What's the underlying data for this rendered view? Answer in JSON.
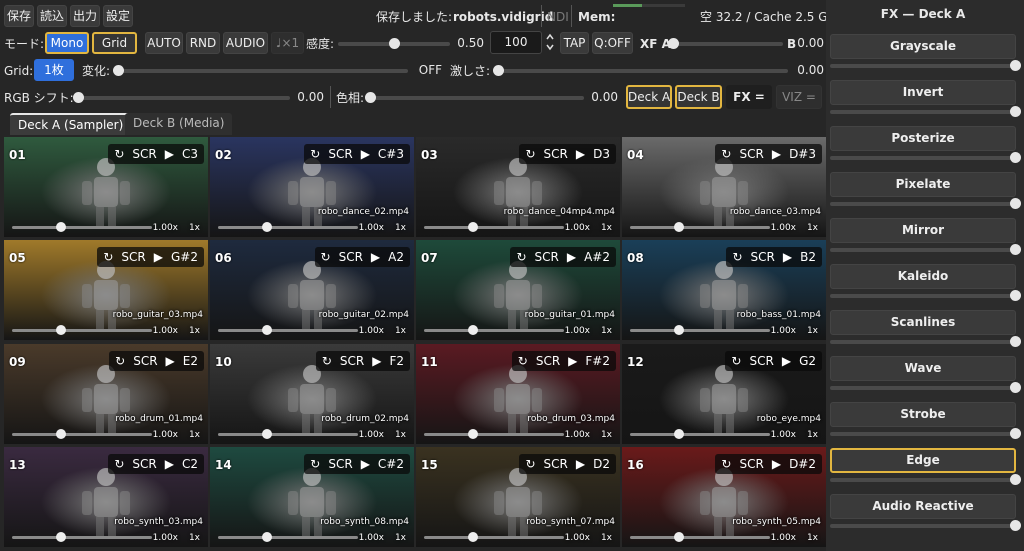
{
  "menu": {
    "save": "保存",
    "load": "読込",
    "output": "出力",
    "settings": "設定"
  },
  "status": {
    "saved_label": "保存しました:",
    "saved_file": "robots.vidigrid",
    "ndi": "NDI",
    "mem_label": "Mem:",
    "mem_value": "空 32.2 / Cache 2.5 GB",
    "mem_fraction": 0.4
  },
  "controls": {
    "mode_label": "モード:",
    "mode_mono": "Mono",
    "mode_grid": "Grid",
    "auto": "AUTO",
    "rnd": "RND",
    "audio": "AUDIO",
    "note": "♩×1",
    "sensitivity_label": "感度:",
    "sensitivity_value": "0.50",
    "sensitivity_fraction": 0.5,
    "bpm_value": "100",
    "tap": "TAP",
    "qoff": "Q:OFF",
    "xf_label": "XF A",
    "xf_b": "B",
    "xf_value": "0.00",
    "xf_fraction": 0.0,
    "grid_label": "Grid:",
    "grid_value": "1枚",
    "change_label": "変化:",
    "change_value": "OFF",
    "change_fraction": 0.0,
    "intensity_label": "激しさ:",
    "intensity_value": "0.00",
    "intensity_fraction": 0.0,
    "rgb_label": "RGB シフト:",
    "rgb_value": "0.00",
    "rgb_fraction": 0.0,
    "hue_label": "色相:",
    "hue_value": "0.00",
    "hue_fraction": 0.0,
    "deck_a": "Deck A",
    "deck_b": "Deck B",
    "fx_eq": "FX =",
    "viz_eq": "VIZ ="
  },
  "tabs": [
    "Deck A (Sampler)",
    "Deck B (Media)"
  ],
  "cells": [
    {
      "num": "01",
      "scr": "SCR",
      "key": "C3",
      "file": "",
      "speed": "1.00x",
      "mul": "1x",
      "pos": 0.35,
      "bg": "#2f5a3e"
    },
    {
      "num": "02",
      "scr": "SCR",
      "key": "C#3",
      "file": "robo_dance_02.mp4",
      "speed": "1.00x",
      "mul": "1x",
      "pos": 0.35,
      "bg": "#2a3560"
    },
    {
      "num": "03",
      "scr": "SCR",
      "key": "D3",
      "file": "robo_dance_04mp4.mp4",
      "speed": "1.00x",
      "mul": "1x",
      "pos": 0.35,
      "bg": "#2a2a2a"
    },
    {
      "num": "04",
      "scr": "SCR",
      "key": "D#3",
      "file": "robo_dance_03.mp4",
      "speed": "1.00x",
      "mul": "1x",
      "pos": 0.35,
      "bg": "#6a6a6a"
    },
    {
      "num": "05",
      "scr": "SCR",
      "key": "G#2",
      "file": "robo_guitar_03.mp4",
      "speed": "1.00x",
      "mul": "1x",
      "pos": 0.35,
      "bg": "#a07a2a"
    },
    {
      "num": "06",
      "scr": "SCR",
      "key": "A2",
      "file": "robo_guitar_02.mp4",
      "speed": "1.00x",
      "mul": "1x",
      "pos": 0.35,
      "bg": "#1e2a3e"
    },
    {
      "num": "07",
      "scr": "SCR",
      "key": "A#2",
      "file": "robo_guitar_01.mp4",
      "speed": "1.00x",
      "mul": "1x",
      "pos": 0.35,
      "bg": "#1e4a3a"
    },
    {
      "num": "08",
      "scr": "SCR",
      "key": "B2",
      "file": "robo_bass_01.mp4",
      "speed": "1.00x",
      "mul": "1x",
      "pos": 0.35,
      "bg": "#1a3f58"
    },
    {
      "num": "09",
      "scr": "SCR",
      "key": "E2",
      "file": "robo_drum_01.mp4",
      "speed": "1.00x",
      "mul": "1x",
      "pos": 0.35,
      "bg": "#4a3a2a"
    },
    {
      "num": "10",
      "scr": "SCR",
      "key": "F2",
      "file": "robo_drum_02.mp4",
      "speed": "1.00x",
      "mul": "1x",
      "pos": 0.35,
      "bg": "#3a3a3a"
    },
    {
      "num": "11",
      "scr": "SCR",
      "key": "F#2",
      "file": "robo_drum_03.mp4",
      "speed": "1.00x",
      "mul": "1x",
      "pos": 0.35,
      "bg": "#5a1a22"
    },
    {
      "num": "12",
      "scr": "SCR",
      "key": "G2",
      "file": "robo_eye.mp4",
      "speed": "1.00x",
      "mul": "1x",
      "pos": 0.35,
      "bg": "#1a1a1a"
    },
    {
      "num": "13",
      "scr": "SCR",
      "key": "C2",
      "file": "robo_synth_03.mp4",
      "speed": "1.00x",
      "mul": "1x",
      "pos": 0.35,
      "bg": "#3a2a40"
    },
    {
      "num": "14",
      "scr": "SCR",
      "key": "C#2",
      "file": "robo_synth_08.mp4",
      "speed": "1.00x",
      "mul": "1x",
      "pos": 0.35,
      "bg": "#1e4a40"
    },
    {
      "num": "15",
      "scr": "SCR",
      "key": "D2",
      "file": "robo_synth_07.mp4",
      "speed": "1.00x",
      "mul": "1x",
      "pos": 0.35,
      "bg": "#3a3220"
    },
    {
      "num": "16",
      "scr": "SCR",
      "key": "D#2",
      "file": "robo_synth_05.mp4",
      "speed": "1.00x",
      "mul": "1x",
      "pos": 0.35,
      "bg": "#6a1a1a"
    }
  ],
  "fx_panel": {
    "title": "FX — Deck A",
    "items": [
      {
        "label": "Grayscale",
        "level": 1.0
      },
      {
        "label": "Invert",
        "level": 1.0
      },
      {
        "label": "Posterize",
        "level": 1.0
      },
      {
        "label": "Pixelate",
        "level": 1.0
      },
      {
        "label": "Mirror",
        "level": 1.0
      },
      {
        "label": "Kaleido",
        "level": 1.0
      },
      {
        "label": "Scanlines",
        "level": 1.0
      },
      {
        "label": "Wave",
        "level": 1.0
      },
      {
        "label": "Strobe",
        "level": 1.0
      },
      {
        "label": "Edge",
        "level": 1.0
      },
      {
        "label": "Audio Reactive",
        "level": 1.0
      }
    ],
    "selected": "Edge"
  },
  "colors": {
    "accent": "#2f6fdc",
    "highlight": "#e2b640"
  }
}
